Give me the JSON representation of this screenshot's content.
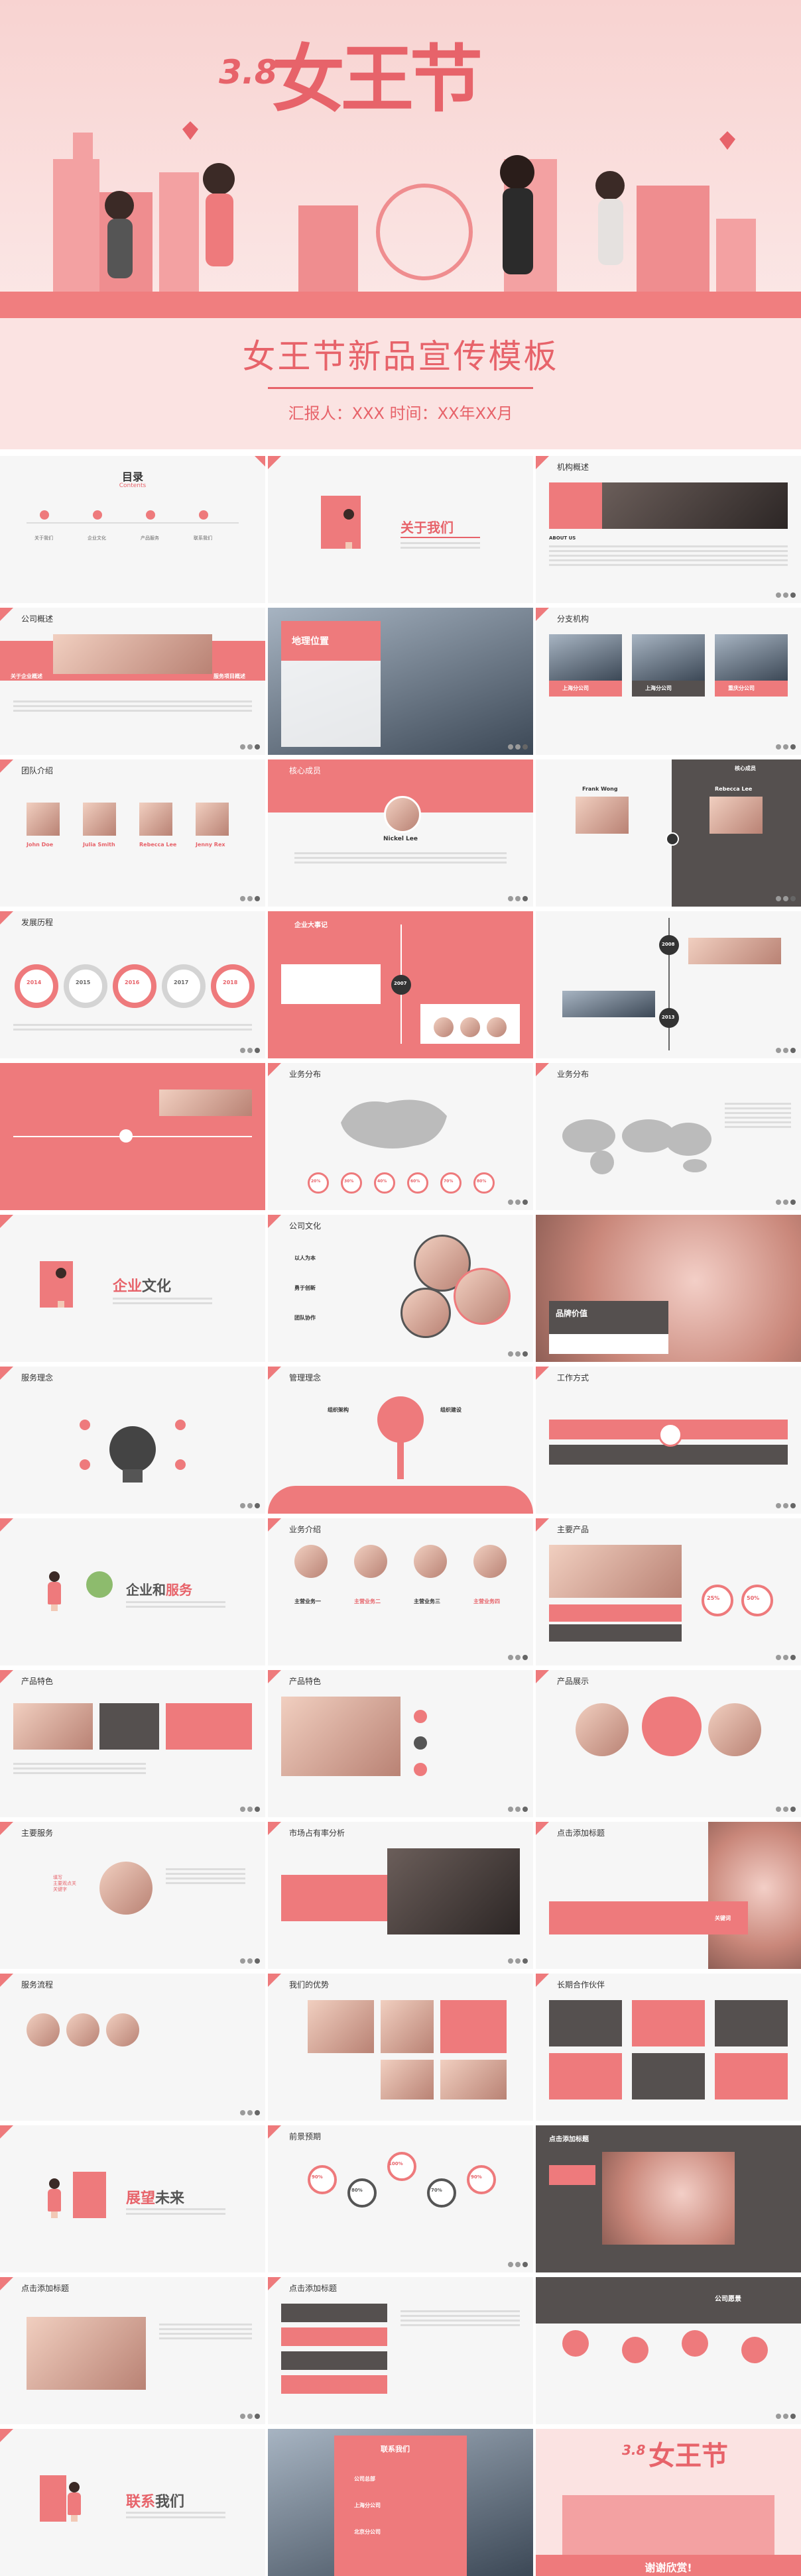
{
  "cover": {
    "logo_number": "3.8",
    "logo_text": "女王节",
    "title": "女王节新品宣传模板",
    "subtitle": "汇报人：XXX  时间：XX年XX月"
  },
  "colors": {
    "accent": "#ee7a7c",
    "accent_text": "#e7636a",
    "dark": "#55504f",
    "bg": "#f6f6f6"
  },
  "slides": {
    "toc": {
      "title": "目录",
      "subtitle": "Contents",
      "items": [
        "关于我们",
        "企业文化",
        "产品服务",
        "联系我们"
      ]
    },
    "about": {
      "title": "关于我们"
    },
    "org": {
      "title": "机构概述",
      "sub": "ABOUT US"
    },
    "company": {
      "title": "公司概述",
      "left_label": "关于企业概述",
      "right_label": "服务项目概述"
    },
    "location": {
      "title": "地理位置"
    },
    "branches": {
      "title": "分支机构",
      "items": [
        "上海分公司",
        "上海分公司",
        "重庆分公司"
      ]
    },
    "team": {
      "title": "团队介绍",
      "names": [
        "John Doe",
        "Julia Smith",
        "Rebecca Lee",
        "Jenny Rex"
      ]
    },
    "core": {
      "title": "核心成员",
      "name": "Nickel Lee"
    },
    "core2": {
      "title": "核心成员",
      "names": [
        "Frank Wong",
        "Rebecca Lee"
      ]
    },
    "history": {
      "title": "发展历程",
      "years": [
        "2014",
        "2015",
        "2016",
        "2017",
        "2018"
      ]
    },
    "events": {
      "title": "企业大事记",
      "year": "2007"
    },
    "timeline": {
      "years": [
        "2008",
        "2013"
      ]
    },
    "map_cn": {
      "title": "业务分布",
      "pcts": [
        "20%",
        "30%",
        "40%",
        "60%",
        "70%",
        "80%"
      ]
    },
    "map_world": {
      "title": "业务分布"
    },
    "culture_cover": {
      "title_a": "企业",
      "title_b": "文化"
    },
    "culture": {
      "title": "公司文化",
      "items": [
        "以人为本",
        "勇于创新",
        "团队协作"
      ]
    },
    "brand": {
      "title": "品牌价值"
    },
    "service_idea": {
      "title": "服务理念"
    },
    "mgmt": {
      "title": "管理理念",
      "left": "组织架构",
      "right": "组织建设"
    },
    "workway": {
      "title": "工作方式"
    },
    "biz_cover": {
      "title_a": "企业和",
      "title_b": "服务"
    },
    "biz": {
      "title": "业务介绍",
      "items": [
        "主营业务一",
        "主营业务二",
        "主营业务三",
        "主营业务四"
      ]
    },
    "product": {
      "title": "主要产品",
      "pcts": [
        "25%",
        "50%"
      ]
    },
    "feature1": {
      "title": "产品特色"
    },
    "feature2": {
      "title": "产品特色"
    },
    "showcase": {
      "title": "产品展示"
    },
    "main_service": {
      "title": "主要服务",
      "center": "填写\n主要观点关\n关键字"
    },
    "market": {
      "title": "市场占有率分析"
    },
    "addtitle": {
      "title": "点击添加标题",
      "label": "关键词"
    },
    "flow": {
      "title": "服务流程"
    },
    "advantage": {
      "title": "我们的优势"
    },
    "partner": {
      "title": "长期合作伙伴"
    },
    "future_cover": {
      "title_a": "展望",
      "title_b": "未来"
    },
    "forecast": {
      "title": "前景预期",
      "pcts": [
        "90%",
        "80%",
        "100%",
        "70%",
        "90%"
      ]
    },
    "addtitle2": {
      "title": "点击添加标题"
    },
    "addtitle3": {
      "title": "点击添加标题"
    },
    "addtitle4": {
      "title": "点击添加标题"
    },
    "vision": {
      "title": "公司愿景"
    },
    "contact_cover": {
      "title_a": "联系",
      "title_b": "我们"
    },
    "contact": {
      "title": "联系我们",
      "items": [
        "公司总部",
        "上海分公司",
        "北京分公司"
      ]
    },
    "thanks": {
      "logo_number": "3.8",
      "logo_text": "女王节",
      "text": "谢谢欣赏!"
    }
  }
}
